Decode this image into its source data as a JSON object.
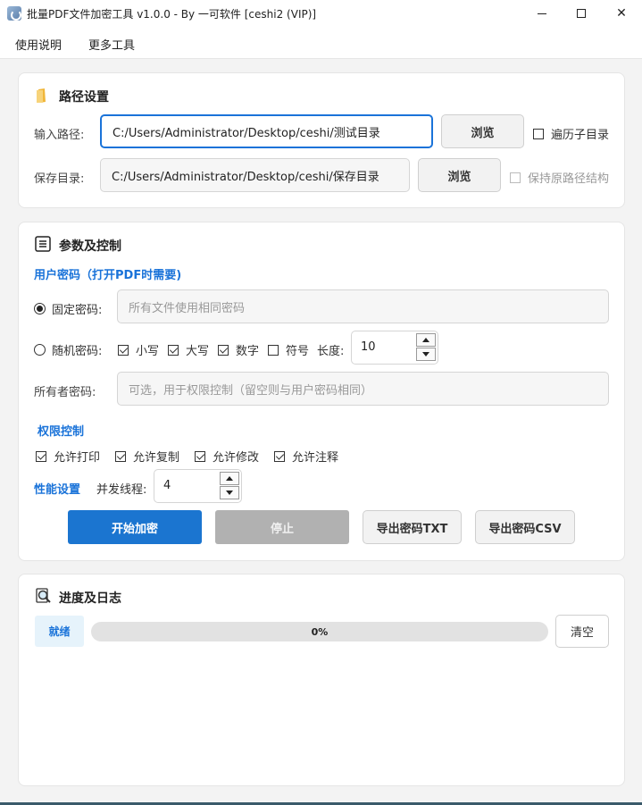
{
  "window": {
    "title": "批量PDF文件加密工具 v1.0.0 - By 一可软件 [ceshi2 (VIP)]",
    "minimize": "—",
    "close": "✕"
  },
  "menu": {
    "items": [
      "使用说明",
      "更多工具"
    ]
  },
  "path_section": {
    "title": "路径设置",
    "input_label": "输入路径:",
    "input_value": "C:/Users/Administrator/Desktop/ceshi/测试目录",
    "input_browse": "浏览",
    "recurse_label": "遍历子目录",
    "recurse_checked": false,
    "save_label": "保存目录:",
    "save_value": "C:/Users/Administrator/Desktop/ceshi/保存目录",
    "save_browse": "浏览",
    "keep_structure_label": "保持原路径结构",
    "keep_structure_checked": false,
    "keep_structure_enabled": false
  },
  "params_section": {
    "title": "参数及控制",
    "user_pw_heading": "用户密码（打开PDF时需要)",
    "fixed_pw_label": "固定密码:",
    "fixed_pw_selected": true,
    "fixed_pw_placeholder": "所有文件使用相同密码",
    "random_pw_label": "随机密码:",
    "random_pw_selected": false,
    "lowercase_label": "小写",
    "lowercase_checked": true,
    "uppercase_label": "大写",
    "uppercase_checked": true,
    "digits_label": "数字",
    "digits_checked": true,
    "symbols_label": "符号",
    "symbols_checked": false,
    "length_label": "长度:",
    "length_value": "10",
    "owner_pw_label": "所有者密码:",
    "owner_pw_placeholder": "可选，用于权限控制（留空则与用户密码相同）",
    "perm_heading": "权限控制",
    "allow_print": "允许打印",
    "allow_copy": "允许复制",
    "allow_modify": "允许修改",
    "allow_annotate": "允许注释",
    "perf_heading": "性能设置",
    "threads_label": "并发线程:",
    "threads_value": "4",
    "start_button": "开始加密",
    "stop_button": "停止",
    "export_txt_button": "导出密码TXT",
    "export_csv_button": "导出密码CSV"
  },
  "log_section": {
    "title": "进度及日志",
    "status": "就绪",
    "progress_percent": 0,
    "progress_text": "0%",
    "clear_button": "清空"
  },
  "colors": {
    "accent": "#1b75d0",
    "heading_blue": "#1a73d9",
    "disabled_button": "#b1b1b1",
    "status_badge_bg": "#e6f3fb"
  }
}
